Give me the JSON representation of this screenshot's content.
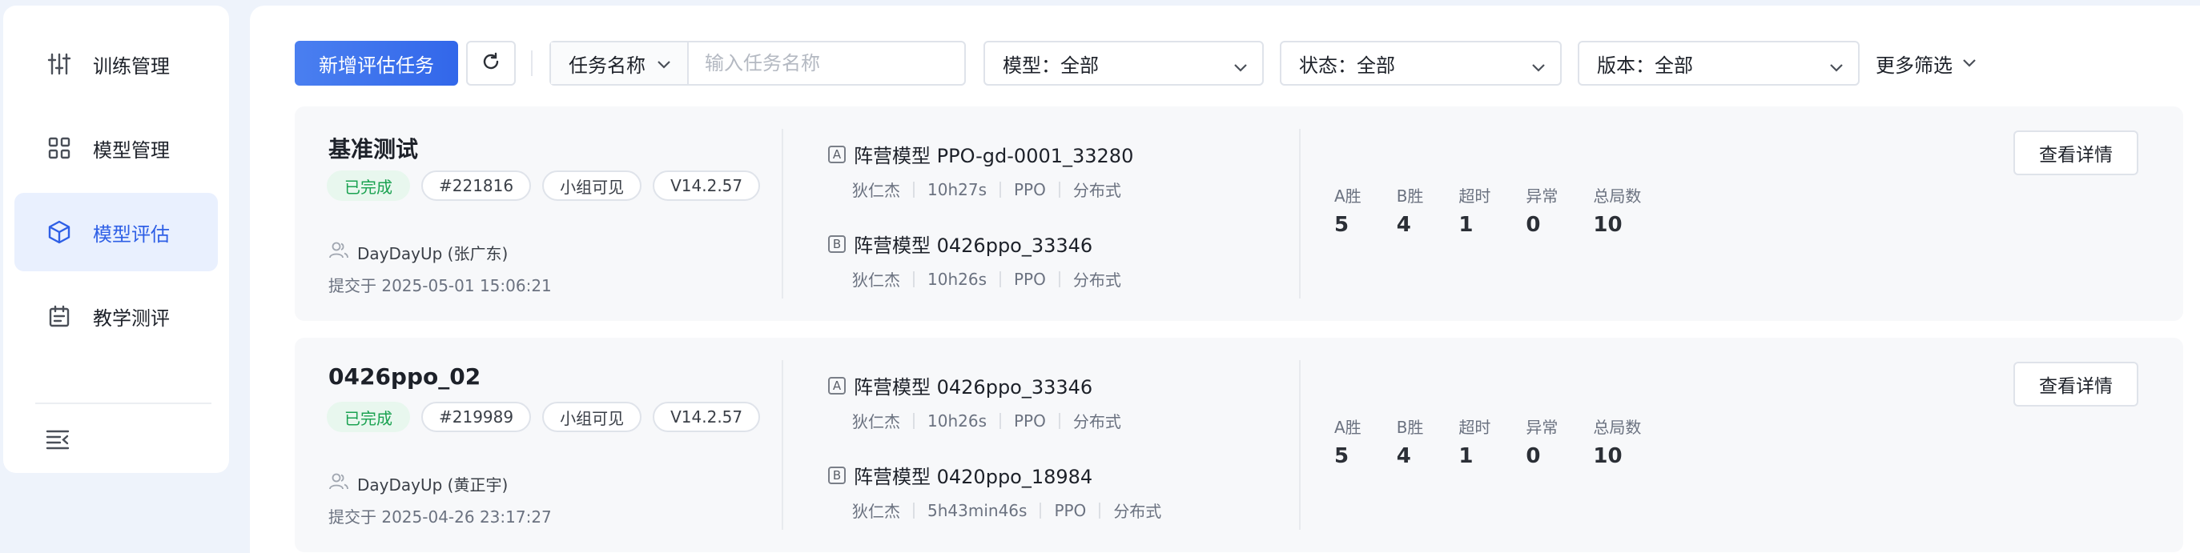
{
  "sidebar": {
    "items": [
      {
        "label": "训练管理",
        "icon": "sliders-icon",
        "active": false
      },
      {
        "label": "模型管理",
        "icon": "grid-icon",
        "active": false
      },
      {
        "label": "模型评估",
        "icon": "cube-icon",
        "active": true
      },
      {
        "label": "教学测评",
        "icon": "calendar-icon",
        "active": false
      }
    ],
    "collapse_icon": "collapse-menu-icon"
  },
  "toolbar": {
    "new_task_label": "新增评估任务",
    "refresh_icon": "refresh-icon",
    "search_type_label": "任务名称",
    "search_placeholder": "输入任务名称",
    "model_filter": "模型：全部",
    "status_filter": "状态：全部",
    "version_filter": "版本：全部",
    "more_filters_label": "更多筛选"
  },
  "colors": {
    "primary": "#3267ea",
    "active_bg": "#e9f0fe",
    "success": "#1aa251"
  },
  "tasks": [
    {
      "title": "基准测试",
      "status": "已完成",
      "id": "#221816",
      "visibility": "小组可见",
      "version": "V14.2.57",
      "submitter": "DayDayUp (张广东)",
      "submit_time": "提交于 2025-05-01 15:06:21",
      "camp_a": {
        "badge": "A",
        "name": "阵营模型 PPO-gd-0001_33280",
        "author": "狄仁杰",
        "duration": "10h27s",
        "algo": "PPO",
        "mode": "分布式"
      },
      "camp_b": {
        "badge": "B",
        "name": "阵营模型 0426ppo_33346",
        "author": "狄仁杰",
        "duration": "10h26s",
        "algo": "PPO",
        "mode": "分布式"
      },
      "stats": [
        {
          "label": "A胜",
          "value": "5"
        },
        {
          "label": "B胜",
          "value": "4"
        },
        {
          "label": "超时",
          "value": "1"
        },
        {
          "label": "异常",
          "value": "0"
        },
        {
          "label": "总局数",
          "value": "10"
        }
      ],
      "detail_label": "查看详情"
    },
    {
      "title": "0426ppo_02",
      "status": "已完成",
      "id": "#219989",
      "visibility": "小组可见",
      "version": "V14.2.57",
      "submitter": "DayDayUp (黄正宇)",
      "submit_time": "提交于 2025-04-26 23:17:27",
      "camp_a": {
        "badge": "A",
        "name": "阵营模型 0426ppo_33346",
        "author": "狄仁杰",
        "duration": "10h26s",
        "algo": "PPO",
        "mode": "分布式"
      },
      "camp_b": {
        "badge": "B",
        "name": "阵营模型 0420ppo_18984",
        "author": "狄仁杰",
        "duration": "5h43min46s",
        "algo": "PPO",
        "mode": "分布式"
      },
      "stats": [
        {
          "label": "A胜",
          "value": "5"
        },
        {
          "label": "B胜",
          "value": "4"
        },
        {
          "label": "超时",
          "value": "1"
        },
        {
          "label": "异常",
          "value": "0"
        },
        {
          "label": "总局数",
          "value": "10"
        }
      ],
      "detail_label": "查看详情"
    }
  ]
}
